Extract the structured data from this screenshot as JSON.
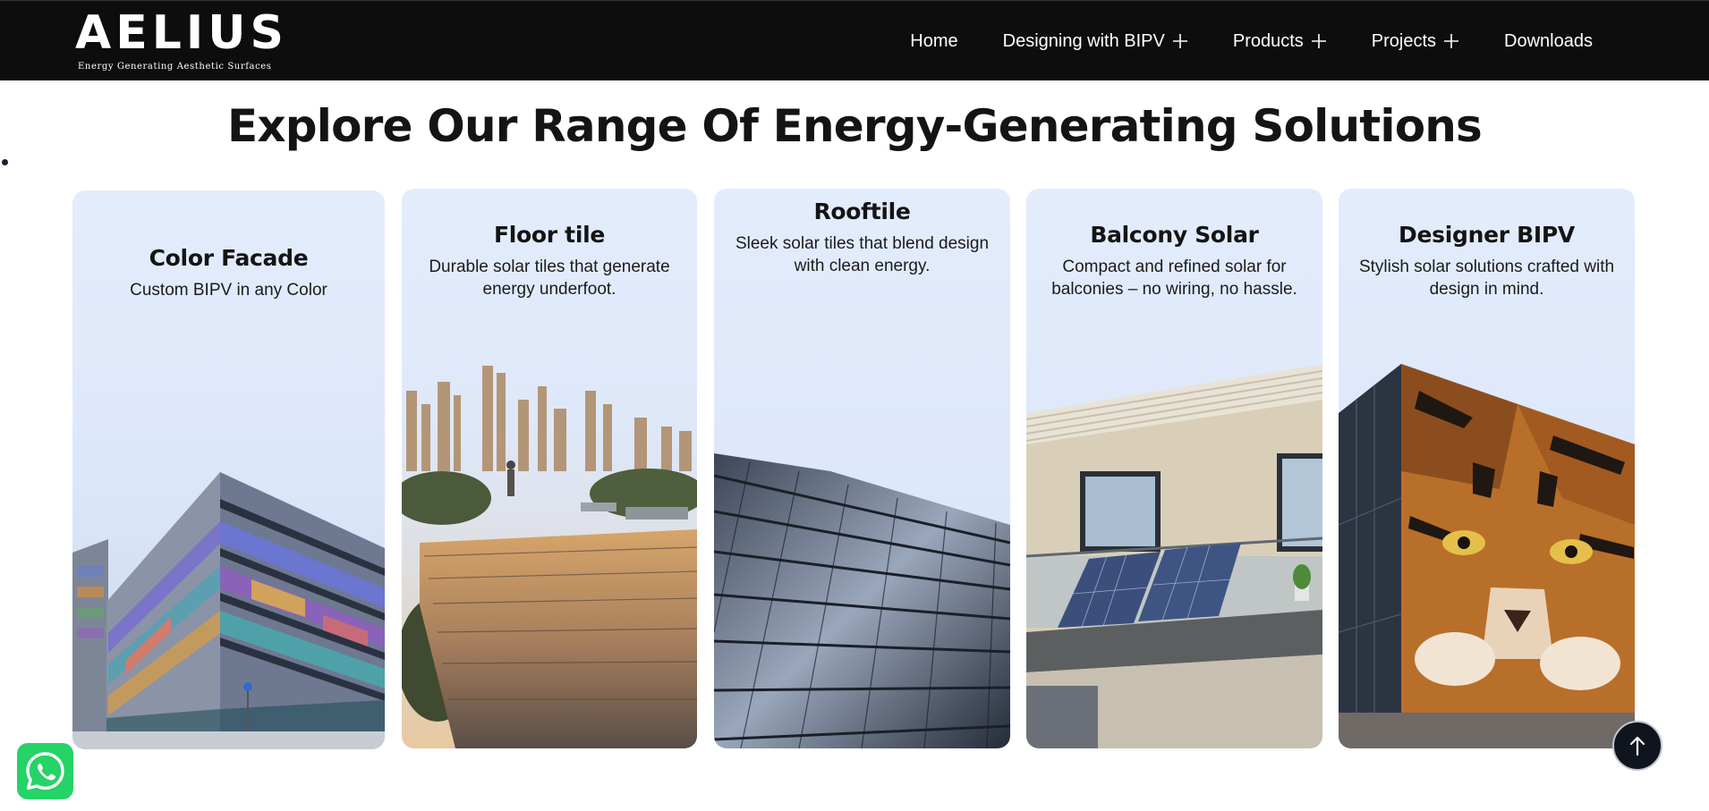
{
  "brand": {
    "logo_text": "AELIUS",
    "tagline": "Energy Generating Aesthetic Surfaces"
  },
  "nav": {
    "home": "Home",
    "designing": "Designing with BIPV",
    "products": "Products",
    "projects": "Projects",
    "downloads": "Downloads"
  },
  "main": {
    "title": "Explore Our Range Of Energy-Generating Solutions"
  },
  "cards": [
    {
      "title": "Color Facade",
      "description": "Custom BIPV in any Color"
    },
    {
      "title": "Floor tile",
      "description": "Durable solar tiles that generate energy underfoot."
    },
    {
      "title": "Rooftile",
      "description": "Sleek solar tiles that blend design with clean energy."
    },
    {
      "title": "Balcony Solar",
      "description": "Compact and refined solar for balconies – no wiring, no hassle."
    },
    {
      "title": "Designer BIPV",
      "description": "Stylish solar solutions crafted with design in mind."
    }
  ],
  "icons": {
    "plus": "plus-icon",
    "whatsapp": "whatsapp-icon",
    "scroll_top": "arrow-up-icon"
  },
  "colors": {
    "header_bg": "#0d0d0d",
    "card_bg": "#e3ecfc",
    "whatsapp_green": "#25d366",
    "scroll_button": "#10141c"
  }
}
